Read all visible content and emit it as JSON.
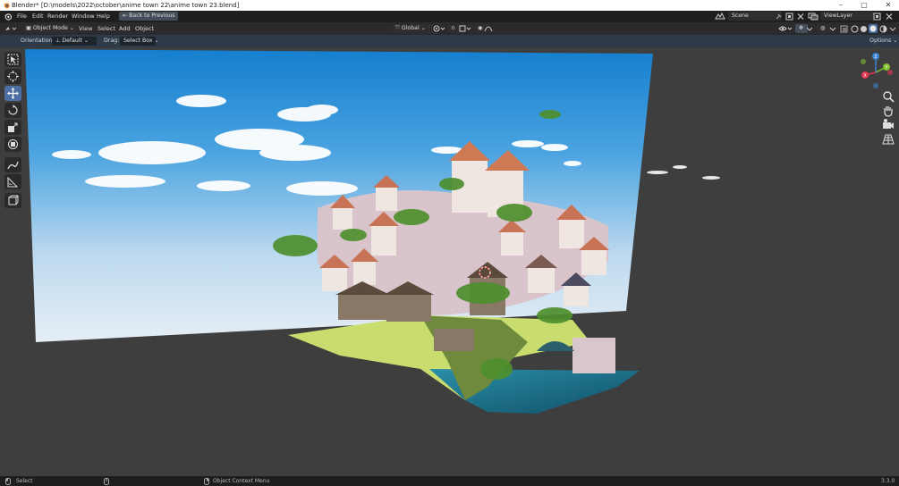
{
  "window": {
    "title": "Blender* [D:\\models\\2022\\october\\anime town 22\\anime town 23.blend]",
    "controls": {
      "minimize": "–",
      "maximize": "▢",
      "close": "✕"
    }
  },
  "menu": {
    "items": [
      "File",
      "Edit",
      "Render",
      "Window",
      "Help"
    ],
    "back_button": "Back to Previous",
    "scene": "Scene",
    "view_layer": "ViewLayer"
  },
  "header": {
    "mode": "Object Mode",
    "menus": [
      "View",
      "Select",
      "Add",
      "Object"
    ],
    "transform_orientation": "Global",
    "options": "Options"
  },
  "tool_settings": {
    "orientation_label": "Orientation:",
    "orientation_value": "Default",
    "drag_label": "Drag:",
    "drag_value": "Select Box"
  },
  "toolbar": {
    "tools": [
      "select-box",
      "cursor",
      "move",
      "rotate",
      "scale",
      "transform",
      "annotate",
      "measure",
      "add-cube"
    ],
    "active_tool": "move"
  },
  "gizmo": {
    "axes": [
      "X",
      "Y",
      "Z"
    ]
  },
  "status": {
    "left_click": "Select",
    "right_click": "Object Context Menu",
    "version": "3.3.0"
  },
  "colors": {
    "accent": "#4d6fa3",
    "axis_x": "#e2354e",
    "axis_y": "#7fbf2a",
    "axis_z": "#3b82d6",
    "sky_top": "#1c8fd8",
    "sky_bottom": "#dce9f4"
  }
}
